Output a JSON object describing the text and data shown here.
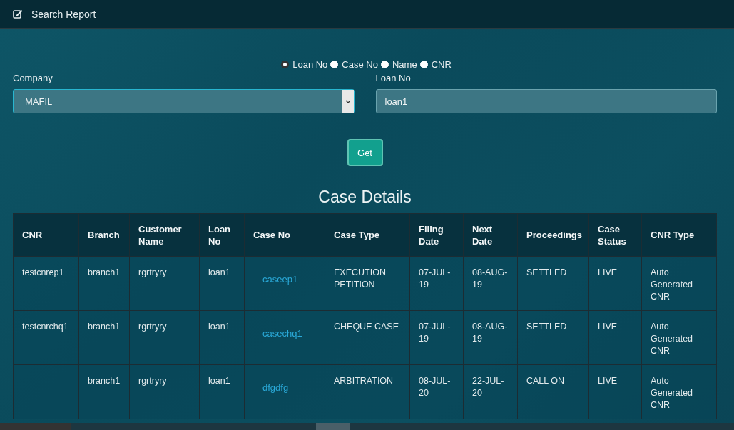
{
  "header": {
    "title": "Search Report"
  },
  "search_by": [
    {
      "label": "Loan No",
      "selected": true
    },
    {
      "label": "Case No",
      "selected": false
    },
    {
      "label": "Name",
      "selected": false
    },
    {
      "label": "CNR",
      "selected": false
    }
  ],
  "company": {
    "label": "Company",
    "value": "MAFIL"
  },
  "loan_no": {
    "label": "Loan No",
    "value": "loan1"
  },
  "get_button": "Get",
  "table": {
    "title": "Case Details",
    "columns": [
      "CNR",
      "Branch",
      "Customer Name",
      "Loan No",
      "Case No",
      "Case Type",
      "Filing Date",
      "Next Date",
      "Proceedings",
      "Case Status",
      "CNR Type"
    ],
    "rows": [
      {
        "cells": [
          "testcnrep1",
          "branch1",
          "rgrtryry",
          "loan1",
          "caseep1",
          "EXECUTION PETITION",
          "07-JUL-19",
          "08-AUG-19",
          "SETTLED",
          "LIVE",
          "Auto Generated CNR"
        ]
      },
      {
        "cells": [
          "testcnrchq1",
          "branch1",
          "rgrtryry",
          "loan1",
          "casechq1",
          "CHEQUE CASE",
          "07-JUL-19",
          "08-AUG-19",
          "SETTLED",
          "LIVE",
          "Auto Generated CNR"
        ]
      },
      {
        "cells": [
          "",
          "branch1",
          "rgrtryry",
          "loan1",
          "dfgdfg",
          "ARBITRATION",
          "08-JUL-20",
          "22-JUL-20",
          "CALL ON",
          "LIVE",
          "Auto Generated CNR"
        ]
      }
    ]
  }
}
